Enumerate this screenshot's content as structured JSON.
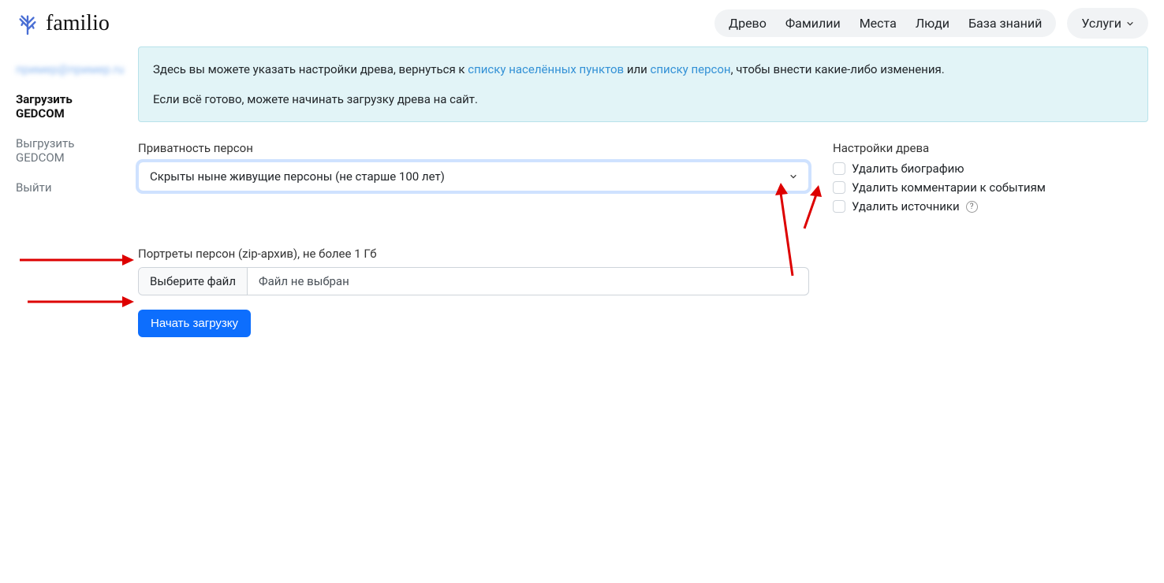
{
  "logo": {
    "text": "familio"
  },
  "nav": {
    "items": [
      "Древо",
      "Фамилии",
      "Места",
      "Люди",
      "База знаний"
    ],
    "services": "Услуги"
  },
  "sidebar": {
    "blurred": "пример@пример.ru",
    "items": [
      {
        "label": "Загрузить GEDCOM",
        "active": true
      },
      {
        "label": "Выгрузить GEDCOM",
        "active": false
      },
      {
        "label": "Выйти",
        "active": false
      }
    ]
  },
  "info": {
    "p1_a": "Здесь вы можете указать настройки древа, вернуться к ",
    "link1": "списку населённых пунктов",
    "p1_b": " или ",
    "link2": "списку персон",
    "p1_c": ", чтобы внести какие-либо изменения.",
    "p2": "Если всё готово, можете начинать загрузку древа на сайт."
  },
  "privacy": {
    "label": "Приватность персон",
    "selected": "Скрыты ныне живущие персоны (не старше 100 лет)"
  },
  "tree_settings": {
    "title": "Настройки древа",
    "opt1": "Удалить биографию",
    "opt2": "Удалить комментарии к событиям",
    "opt3": "Удалить источники"
  },
  "portraits": {
    "label": "Портреты персон (zip-архив), не более 1 Гб",
    "button": "Выберите файл",
    "no_file": "Файл не выбран"
  },
  "submit": "Начать загрузку"
}
